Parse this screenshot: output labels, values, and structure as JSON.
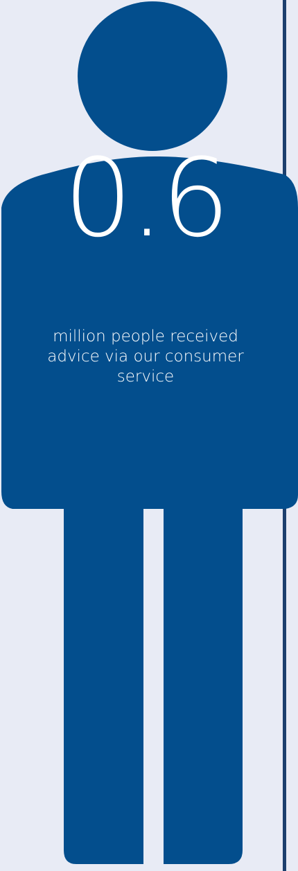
{
  "stat": {
    "value": "0.6",
    "caption": "million people received advice via our consumer service"
  },
  "colors": {
    "background": "#e8ebf5",
    "figure": "#034e8d",
    "divider": "#1c3f6d",
    "text": "#ffffff"
  },
  "icons": {
    "figure": "person-silhouette-icon"
  }
}
